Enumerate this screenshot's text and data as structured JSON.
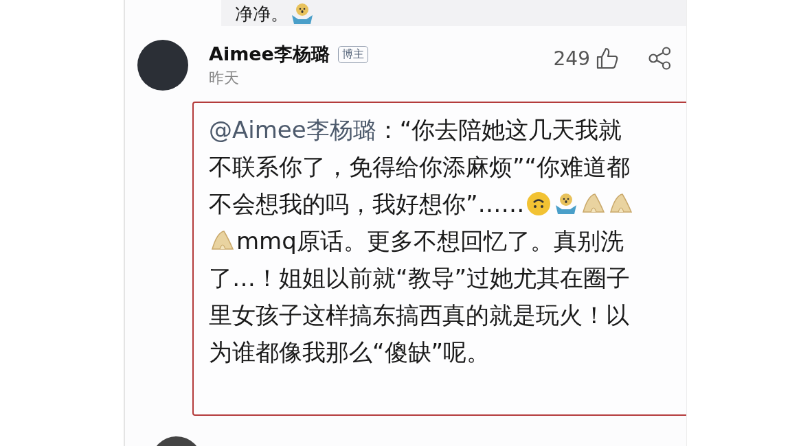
{
  "previous_comment": {
    "segments": [
      {
        "kind": "text",
        "text": "净净。"
      },
      {
        "kind": "hands-emoji"
      }
    ]
  },
  "comment": {
    "author": "Aimee李杨璐",
    "badge": "博主",
    "time": "昨天",
    "likes": "249",
    "highlighted": true,
    "lines": [
      [
        {
          "kind": "mention",
          "text": "@Aimee李杨璐"
        },
        {
          "kind": "text",
          "text": "：“你去陪她这几天我就"
        }
      ],
      [
        {
          "kind": "text",
          "text": "不联系你了，免得给你添麻烦”“你难道都"
        }
      ],
      [
        {
          "kind": "text",
          "text": "不会想我的吗，我好想你”……"
        },
        {
          "kind": "face-emoji"
        },
        {
          "kind": "hands-emoji"
        },
        {
          "kind": "bow-emoji"
        },
        {
          "kind": "bow-emoji"
        }
      ],
      [
        {
          "kind": "bow-emoji"
        },
        {
          "kind": "text",
          "text": "mmq原话。更多不想回忆了。真别洗"
        }
      ],
      [
        {
          "kind": "text",
          "text": "了…！姐姐以前就“教导”过她尤其在圈子"
        }
      ],
      [
        {
          "kind": "text",
          "text": "里女孩子这样搞东搞西真的就是玩火！以"
        }
      ],
      [
        {
          "kind": "text",
          "text": "为谁都像我那么“傻缺”呢。"
        }
      ]
    ]
  }
}
